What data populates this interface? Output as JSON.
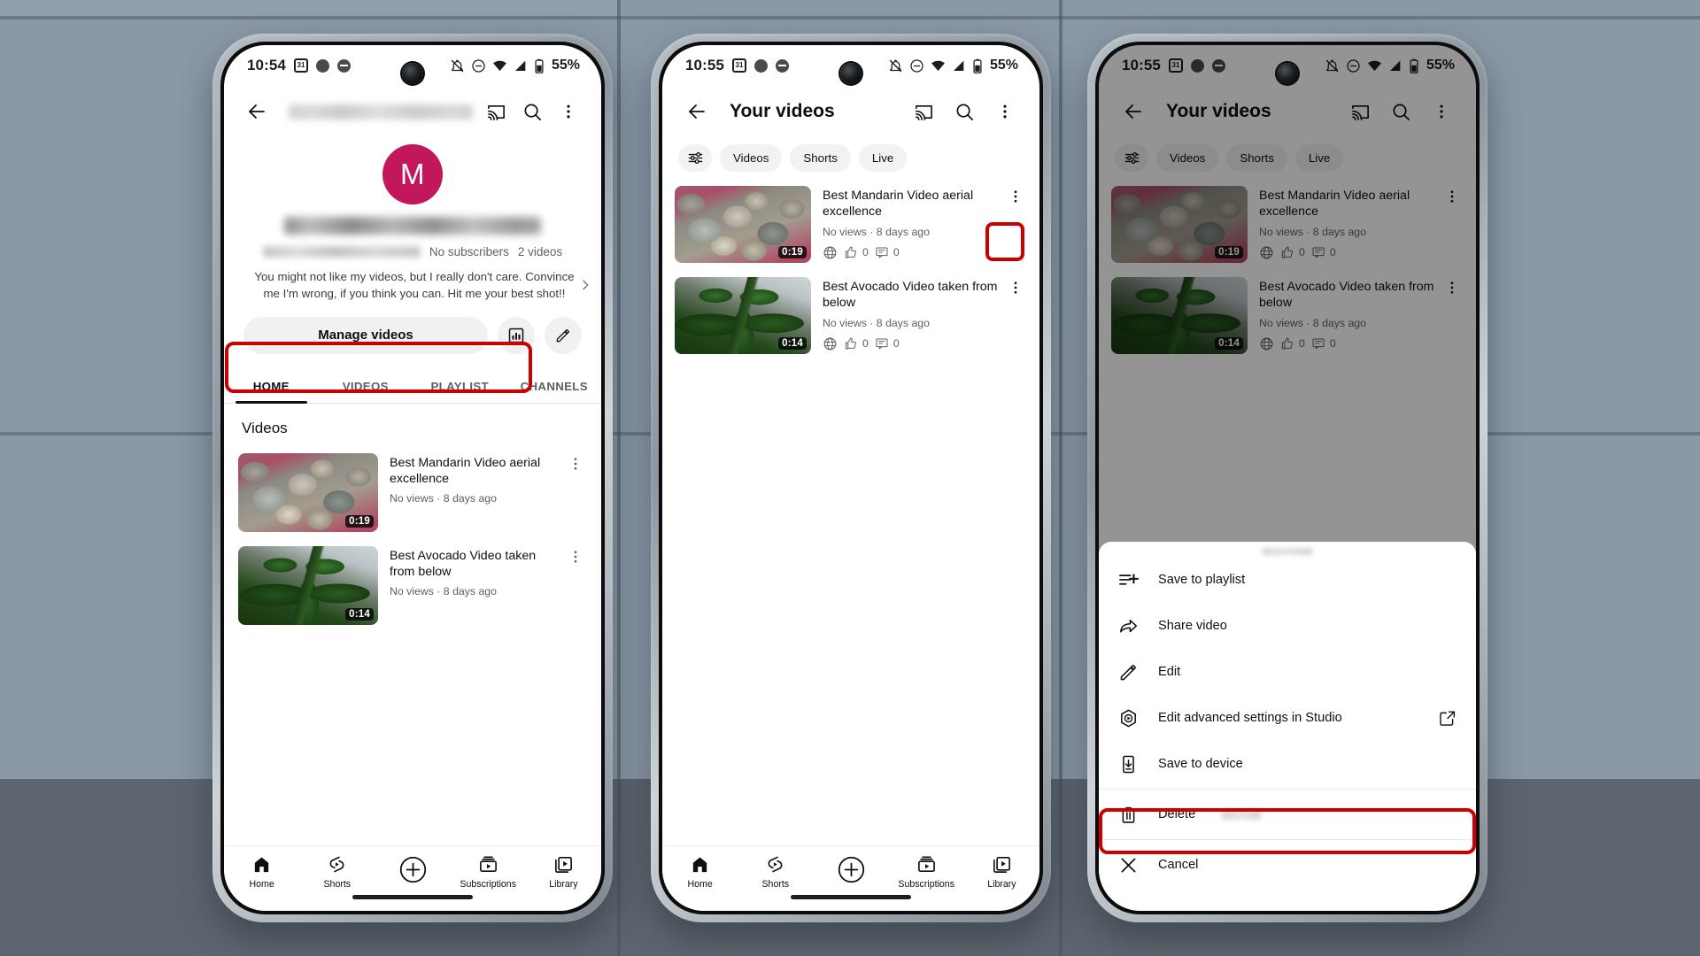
{
  "background": {
    "upper_color": "#8b99a7",
    "lower_color": "#5d6670"
  },
  "phones": [
    {
      "id": "phone-1-channel",
      "status_bar": {
        "clock": "10:54",
        "calendar_day": "31",
        "battery_percent": "55%",
        "icons": [
          "calendar-icon",
          "dot-icon",
          "minus-circle-icon",
          "bell-muted-icon",
          "do-not-disturb-icon",
          "wifi-icon",
          "signal-icon",
          "battery-icon"
        ]
      },
      "app_bar": {
        "back_label": "back-arrow",
        "title_blurred": true,
        "cast_label": "cast-icon",
        "search_label": "search-icon",
        "more_label": "more-icon"
      },
      "channel": {
        "avatar_letter": "M",
        "avatar_color": "#c2185b",
        "name_blurred": true,
        "handle_blurred": true,
        "subscribers": "No subscribers",
        "videos_count": "2 videos",
        "description": "You might not like my videos, but I really don't care. Convince me I'm wrong, if you think you can. Hit me your best shot!!"
      },
      "actions": {
        "manage_videos_label": "Manage videos",
        "analytics_label": "analytics-icon",
        "edit_label": "edit-icon",
        "highlight_color": "#cc0000"
      },
      "tabs": [
        {
          "label": "HOME",
          "active": true
        },
        {
          "label": "VIDEOS",
          "active": false
        },
        {
          "label": "PLAYLIST",
          "active": false
        },
        {
          "label": "CHANNELS",
          "active": false
        }
      ],
      "section_title": "Videos",
      "videos": [
        {
          "title": "Best Mandarin Video aerial excellence",
          "meta": "No views · 8 days ago",
          "duration": "0:19",
          "thumb": "th-mandarin"
        },
        {
          "title": "Best Avocado Video taken from below",
          "meta": "No views · 8 days ago",
          "duration": "0:14",
          "thumb": "th-avocado"
        }
      ],
      "bottom_nav": [
        {
          "label": "Home",
          "icon": "home-icon"
        },
        {
          "label": "Shorts",
          "icon": "shorts-icon"
        },
        {
          "label": "",
          "icon": "create-plus-icon"
        },
        {
          "label": "Subscriptions",
          "icon": "subscriptions-icon"
        },
        {
          "label": "Library",
          "icon": "library-icon"
        }
      ]
    },
    {
      "id": "phone-2-your-videos",
      "status_bar": {
        "clock": "10:55",
        "calendar_day": "31",
        "battery_percent": "55%"
      },
      "app_bar": {
        "title": "Your videos"
      },
      "chips": [
        {
          "label": "",
          "icon": "filter-icon"
        },
        {
          "label": "Videos"
        },
        {
          "label": "Shorts"
        },
        {
          "label": "Live"
        }
      ],
      "videos": [
        {
          "title": "Best Mandarin Video aerial excellence",
          "meta": "No views · 8 days ago",
          "duration": "0:19",
          "visibility": "public-globe-icon",
          "likes": "0",
          "comments": "0",
          "thumb": "th-mandarin",
          "kebab_highlighted": true
        },
        {
          "title": "Best Avocado Video taken from below",
          "meta": "No views · 8 days ago",
          "duration": "0:14",
          "visibility": "public-globe-icon",
          "likes": "0",
          "comments": "0",
          "thumb": "th-avocado",
          "kebab_highlighted": false
        }
      ],
      "bottom_nav": [
        {
          "label": "Home",
          "icon": "home-icon"
        },
        {
          "label": "Shorts",
          "icon": "shorts-icon"
        },
        {
          "label": "",
          "icon": "create-plus-icon"
        },
        {
          "label": "Subscriptions",
          "icon": "subscriptions-icon"
        },
        {
          "label": "Library",
          "icon": "library-icon"
        }
      ]
    },
    {
      "id": "phone-3-video-menu",
      "status_bar": {
        "clock": "10:55",
        "calendar_day": "31",
        "battery_percent": "55%"
      },
      "app_bar": {
        "title": "Your videos"
      },
      "chips": [
        {
          "label": "",
          "icon": "filter-icon"
        },
        {
          "label": "Videos"
        },
        {
          "label": "Shorts"
        },
        {
          "label": "Live"
        }
      ],
      "videos": [
        {
          "title": "Best Mandarin Video aerial excellence",
          "meta": "No views · 8 days ago",
          "duration": "0:19",
          "likes": "0",
          "comments": "0",
          "thumb": "th-mandarin"
        },
        {
          "title": "Best Avocado Video taken from below",
          "meta": "No views · 8 days ago",
          "duration": "0:14",
          "likes": "0",
          "comments": "0",
          "thumb": "th-avocado"
        }
      ],
      "sheet": {
        "items": [
          {
            "label": "Save to playlist",
            "icon": "save-to-playlist-icon",
            "external": false,
            "highlighted": false
          },
          {
            "label": "Share video",
            "icon": "share-icon",
            "external": false,
            "highlighted": false
          },
          {
            "label": "Edit",
            "icon": "pencil-icon",
            "external": false,
            "highlighted": false
          },
          {
            "label": "Edit advanced settings in Studio",
            "icon": "studio-icon",
            "external": true,
            "highlighted": false
          },
          {
            "label": "Save to device",
            "icon": "download-icon",
            "external": false,
            "highlighted": false
          },
          {
            "label": "Delete",
            "icon": "trash-icon",
            "external": false,
            "highlighted": true
          },
          {
            "label": "Cancel",
            "icon": "close-icon",
            "external": false,
            "highlighted": false
          }
        ],
        "highlight_color": "#cc0000"
      }
    }
  ]
}
